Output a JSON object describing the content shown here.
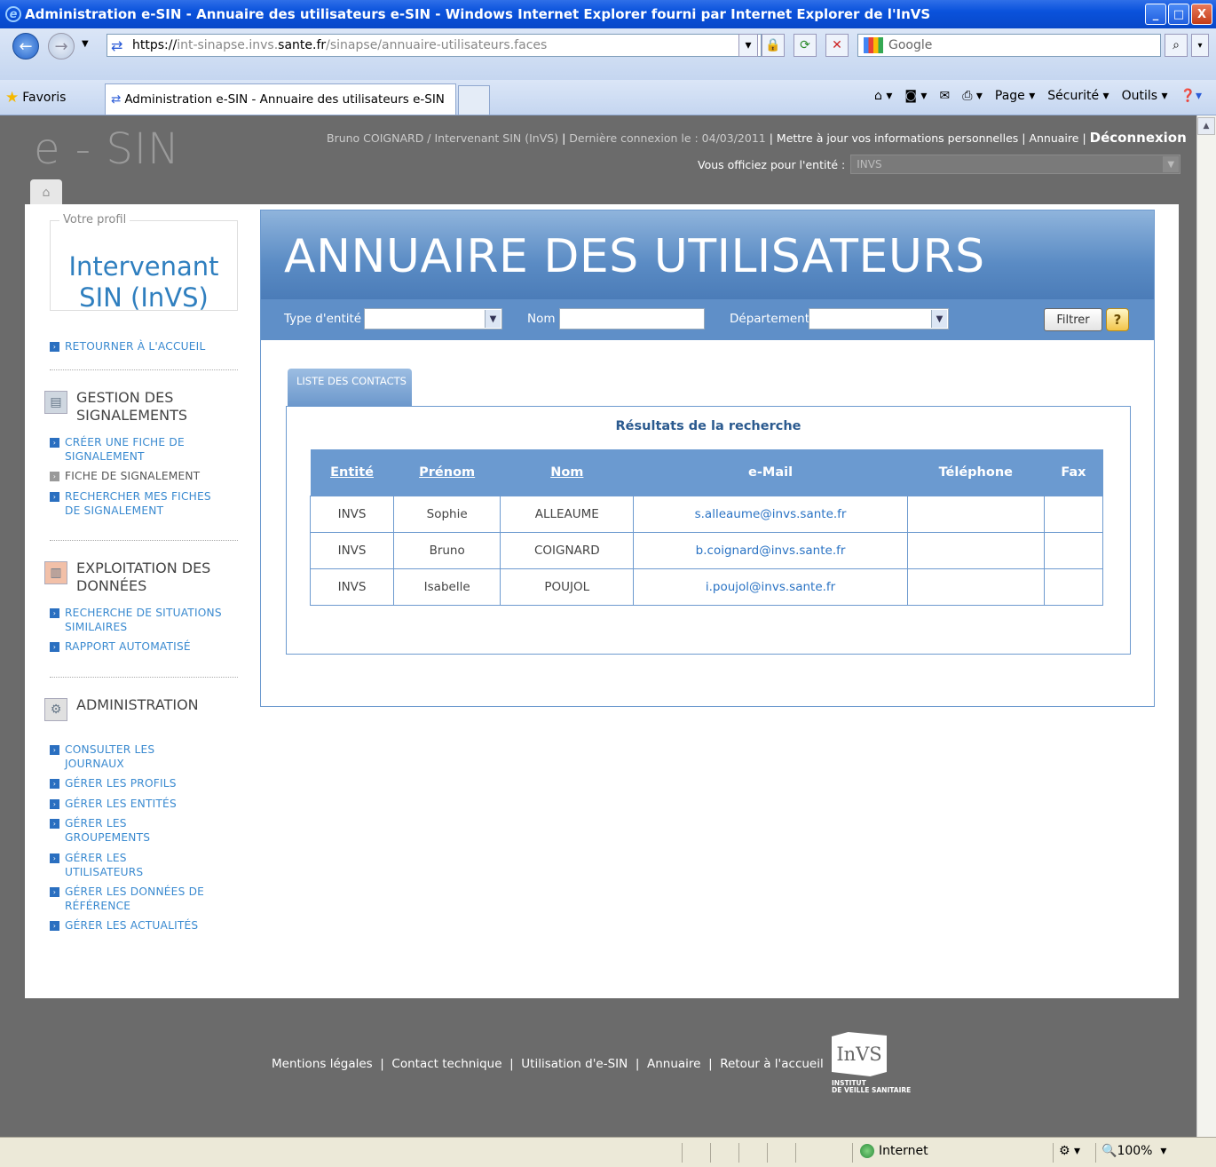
{
  "window": {
    "title": "Administration e-SIN - Annuaire des utilisateurs e-SIN - Windows Internet Explorer fourni par Internet Explorer de l'InVS",
    "buttons": {
      "minimize": "_",
      "maximize": "□",
      "close": "X"
    }
  },
  "browser": {
    "url_prefix": "https://",
    "url_host_pre": "int-sinapse.invs.",
    "url_host_bold": "sante.fr",
    "url_path": "/sinapse/annuaire-utilisateurs.faces",
    "search_placeholder": "Google",
    "favorites_label": "Favoris",
    "tab_title": "Administration e-SIN - Annuaire des utilisateurs e-SIN",
    "cmd": {
      "page": "Page",
      "securite": "Sécurité",
      "outils": "Outils"
    }
  },
  "header": {
    "logo": "e - SIN",
    "user": "Bruno COIGNARD / Intervenant SIN (InVS)",
    "sep": " | ",
    "last_login": "Dernière connexion le : 04/03/2011",
    "update_info": "Mettre à jour vos informations personnelles",
    "annuaire": "Annuaire",
    "logout": "Déconnexion",
    "entity_label": "Vous officiez pour l'entité :",
    "entity_value": "INVS"
  },
  "sidebar": {
    "profile_legend": "Votre profil",
    "profile_title": "Intervenant SIN (InVS)",
    "home_link": "RETOURNER À L'ACCUEIL",
    "sections": [
      {
        "title": "GESTION DES SIGNALEMENTS",
        "icon": "document-icon",
        "items": [
          "CRÉER UNE FICHE DE SIGNALEMENT",
          "FICHE DE SIGNALEMENT",
          "RECHERCHER MES FICHES DE SIGNALEMENT"
        ]
      },
      {
        "title": "EXPLOITATION DES DONNÉES",
        "icon": "chart-icon",
        "items": [
          "RECHERCHE DE SITUATIONS SIMILAIRES",
          "RAPPORT AUTOMATISÉ"
        ]
      },
      {
        "title": "ADMINISTRATION",
        "icon": "gears-icon",
        "items": [
          "CONSULTER LES JOURNAUX",
          "GÉRER LES PROFILS",
          "GÉRER LES ENTITÉS",
          "GÉRER LES GROUPEMENTS",
          "GÉRER LES UTILISATEURS",
          "GÉRER LES DONNÉES DE RÉFÉRENCE",
          "GÉRER LES ACTUALITÉS"
        ]
      }
    ]
  },
  "main": {
    "banner": "ANNUAIRE DES UTILISATEURS",
    "filters": {
      "type_label": "Type d'entité",
      "nom_label": "Nom",
      "dept_label": "Département",
      "button": "Filtrer",
      "help": "?"
    },
    "tab": "LISTE DES CONTACTS",
    "results_title": "Résultats de la recherche",
    "columns": [
      "Entité",
      "Prénom",
      "Nom",
      "e-Mail",
      "Téléphone",
      "Fax"
    ],
    "rows": [
      [
        "INVS",
        "Sophie",
        "ALLEAUME",
        "s.alleaume@invs.sante.fr",
        "",
        ""
      ],
      [
        "INVS",
        "Bruno",
        "COIGNARD",
        "b.coignard@invs.sante.fr",
        "",
        ""
      ],
      [
        "INVS",
        "Isabelle",
        "POUJOL",
        "i.poujol@invs.sante.fr",
        "",
        ""
      ]
    ]
  },
  "footer": {
    "links": [
      "Mentions légales",
      "Contact technique",
      "Utilisation d'e-SIN",
      "Annuaire",
      "Retour à l'accueil"
    ],
    "logo_text": "InVS",
    "logo_sub1": "INSTITUT",
    "logo_sub2": "DE VEILLE SANITAIRE"
  },
  "status": {
    "zone": "Internet",
    "zoom": "100%"
  }
}
